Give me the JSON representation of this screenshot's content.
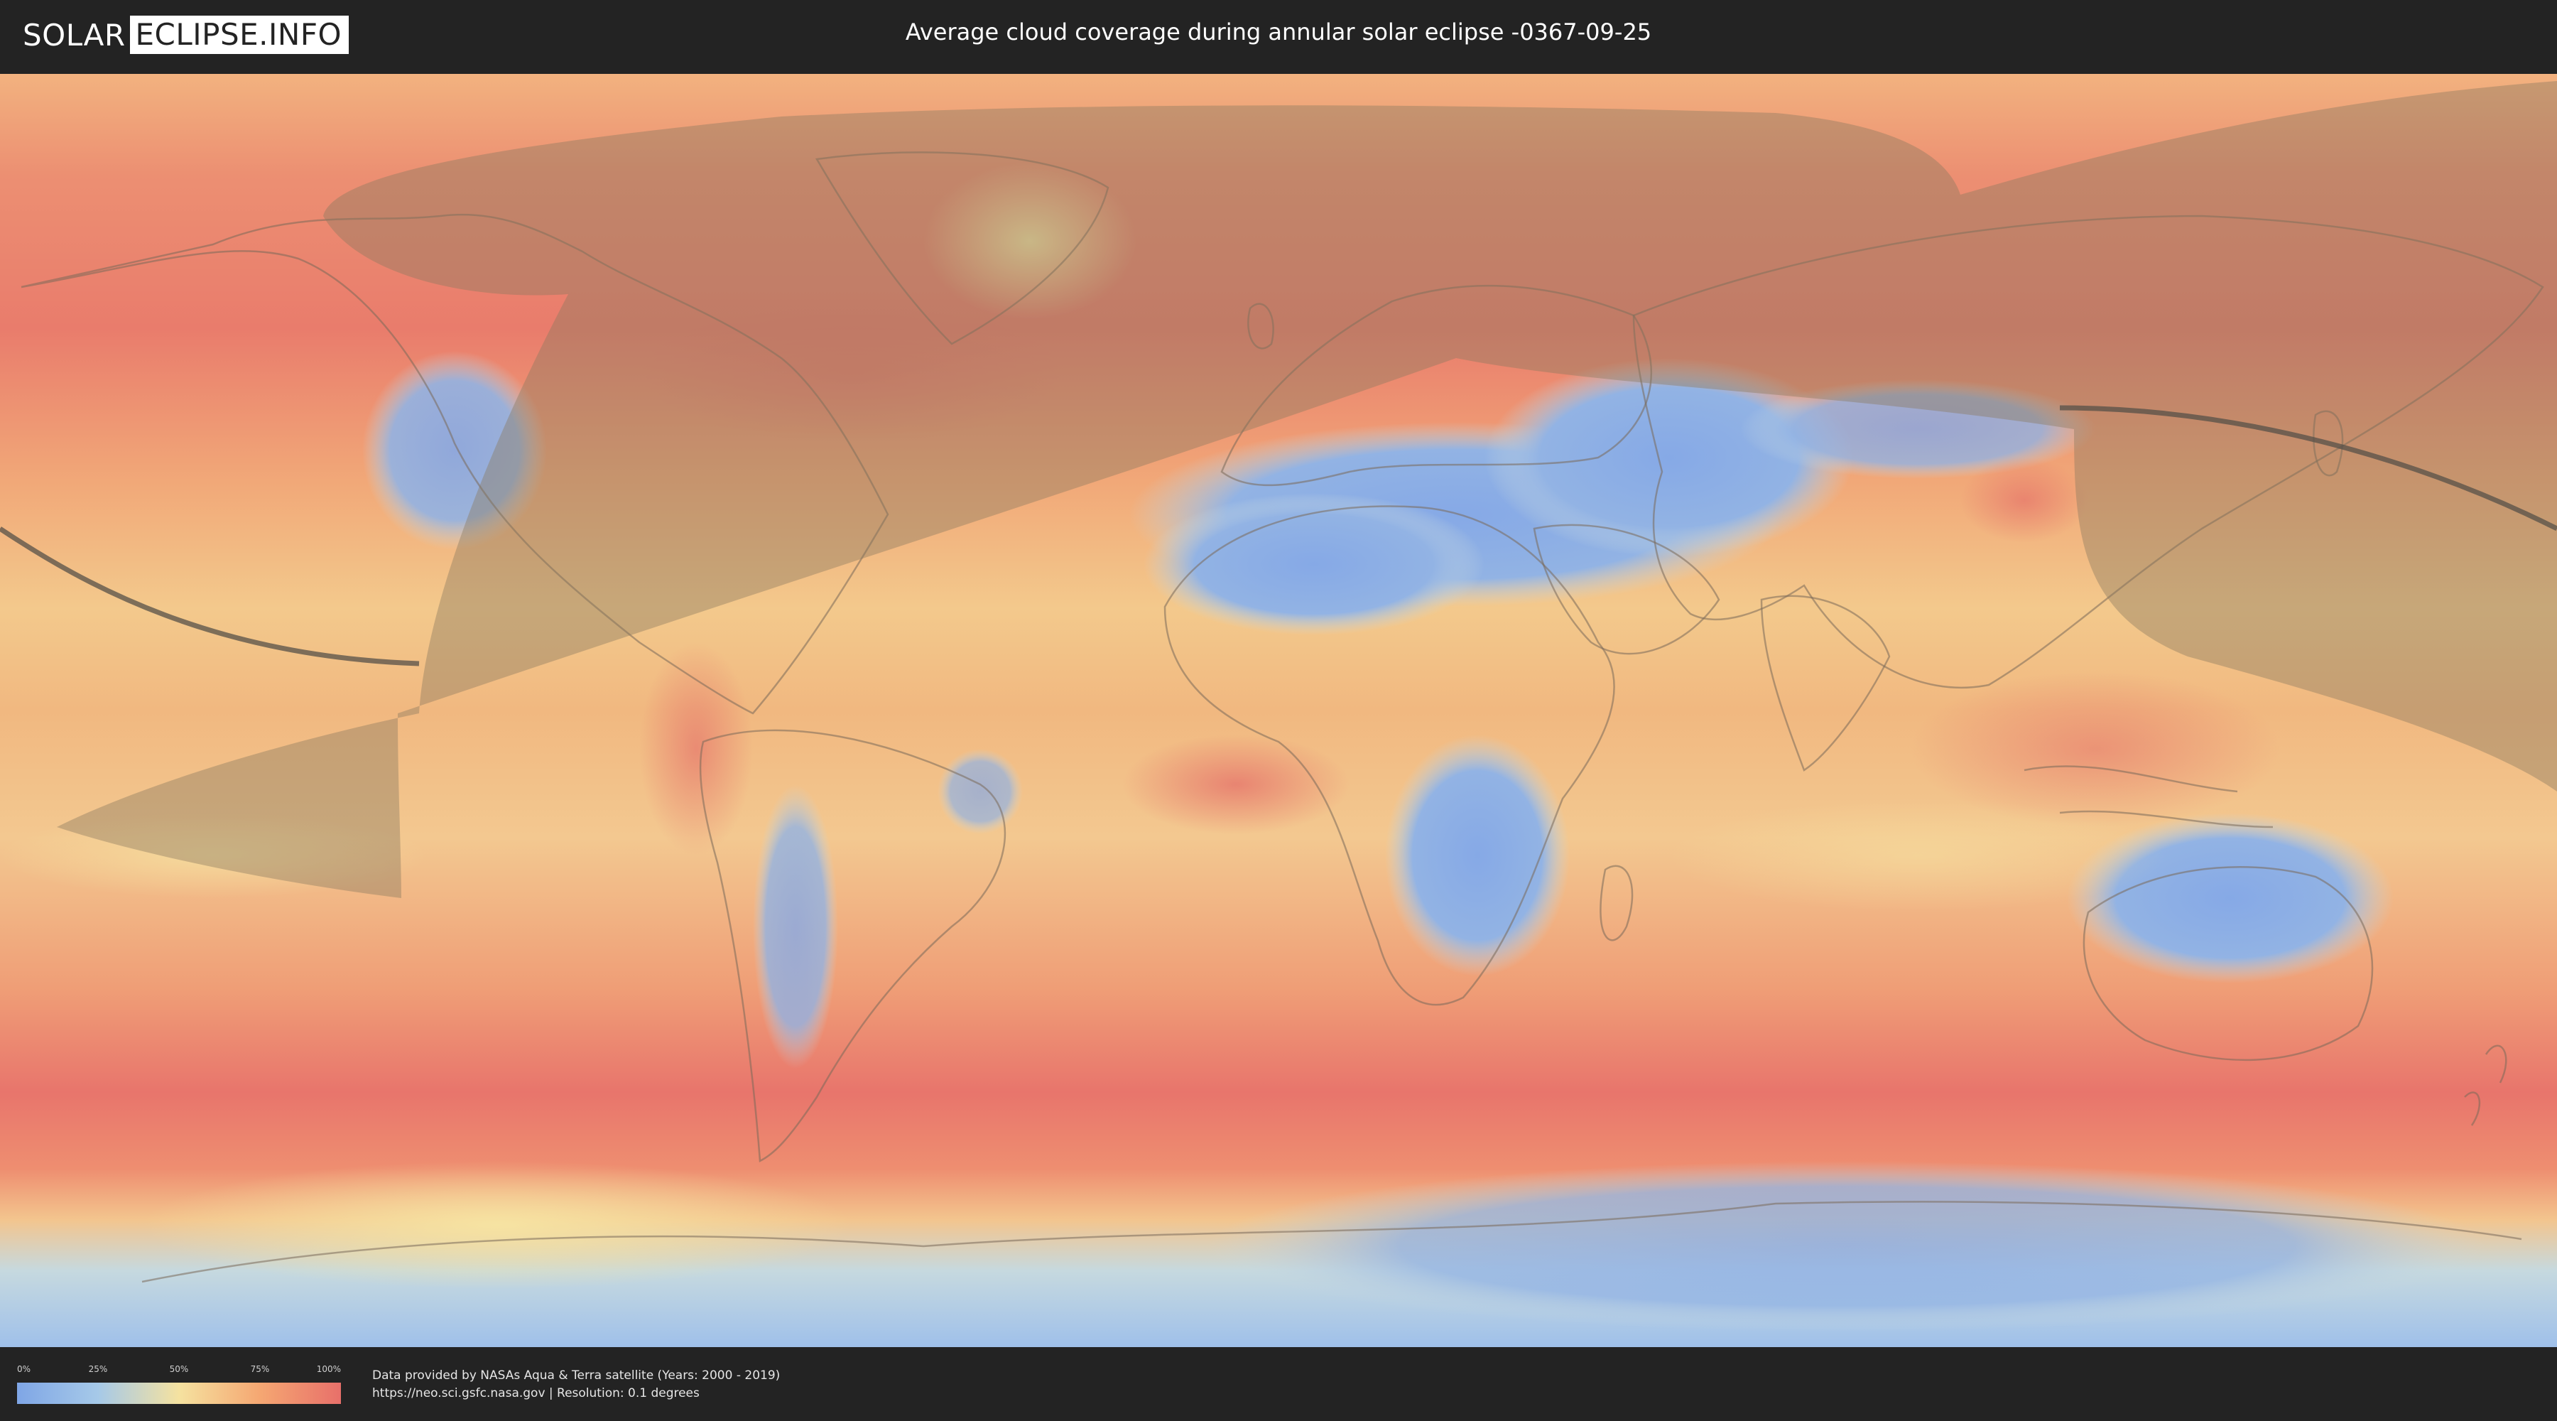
{
  "header": {
    "logo_left": "SOLAR",
    "logo_right": "ECLIPSE.INFO",
    "title": "Average cloud coverage during annular solar eclipse -0367-09-25"
  },
  "map": {
    "layer": "average cloud coverage",
    "colors": {
      "clear": "#7fa6e6",
      "low": "#a6c9e8",
      "mid": "#f5e2a0",
      "high": "#f5a772",
      "overcast": "#e8706a",
      "eclipse_shade": "#8a7a60",
      "central_line": "#555048",
      "borders": "#7a6a5a"
    }
  },
  "legend": {
    "ticks": [
      "0%",
      "25%",
      "50%",
      "75%",
      "100%"
    ],
    "tick_values": [
      0,
      25,
      50,
      75,
      100
    ],
    "colors": [
      "#7fa6e6",
      "#a6c9e8",
      "#f5e2a0",
      "#f5a772",
      "#e8706a"
    ]
  },
  "credit": {
    "line1": "Data provided by NASAs Aqua & Terra satellite (Years: 2000 - 2019)",
    "line2": "https://neo.sci.gsfc.nasa.gov | Resolution: 0.1 degrees"
  }
}
